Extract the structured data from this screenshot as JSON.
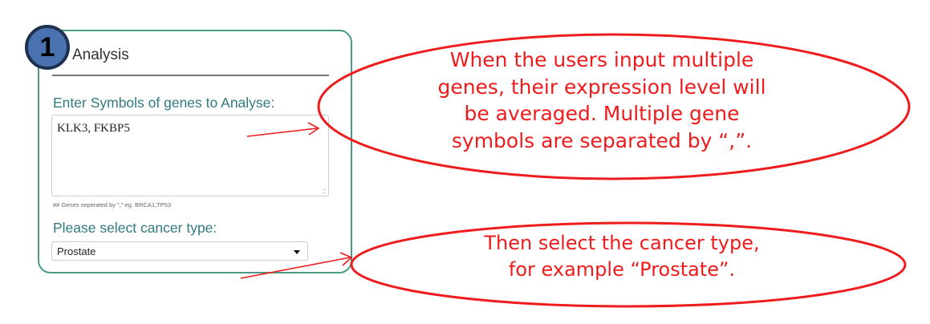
{
  "panel": {
    "step_number": "1",
    "title": "Analysis",
    "genes_label": "Enter Symbols of genes to Analyse:",
    "genes_value": "KLK3, FKBP5",
    "genes_hint": "## Genes seperated by \",\" eg. BRCA1,TP53",
    "cancer_label": "Please select cancer type:",
    "cancer_selected": "Prostate"
  },
  "annotations": {
    "callout_1_lines": [
      "When the users input multiple",
      "genes, their expression level will",
      "be averaged. Multiple gene",
      "symbols are separated by “,”."
    ],
    "callout_2_lines": [
      "Then select the cancer type,",
      "for example “Prostate”."
    ]
  },
  "colors": {
    "panel_border": "#4a9a8a",
    "label_teal": "#317a80",
    "annotation_red": "#ee1c1c",
    "badge_fill": "#4a72b0"
  },
  "icons": {
    "select_caret": "chevron-down-icon",
    "textarea_grip": "resize-grip-icon"
  }
}
